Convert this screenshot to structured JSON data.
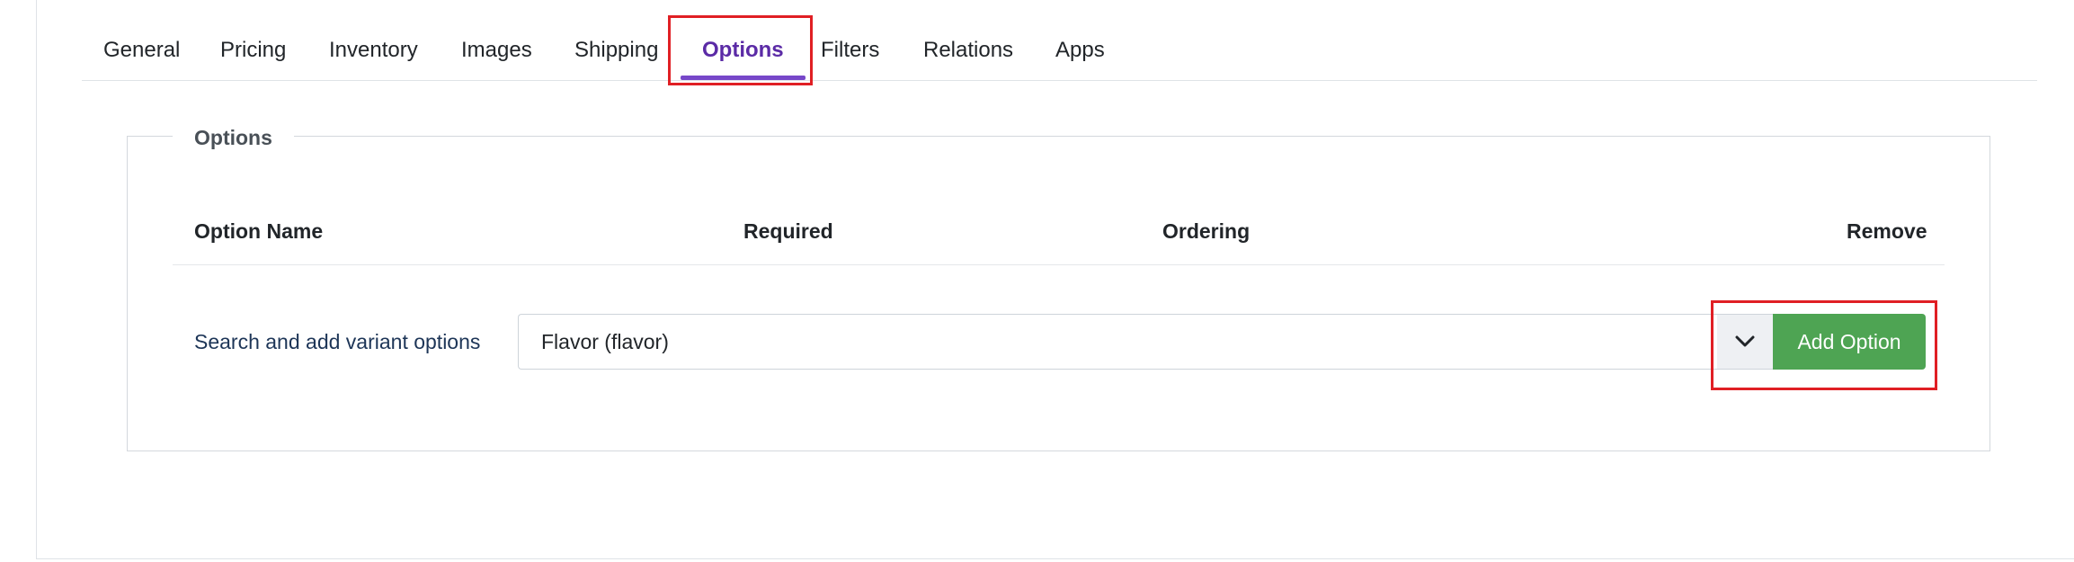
{
  "tabs": [
    {
      "label": "General"
    },
    {
      "label": "Pricing"
    },
    {
      "label": "Inventory"
    },
    {
      "label": "Images"
    },
    {
      "label": "Shipping"
    },
    {
      "label": "Options",
      "active": true
    },
    {
      "label": "Filters"
    },
    {
      "label": "Relations"
    },
    {
      "label": "Apps"
    }
  ],
  "options_panel": {
    "legend": "Options",
    "columns": {
      "option_name": "Option Name",
      "required": "Required",
      "ordering": "Ordering",
      "remove": "Remove"
    },
    "search_label": "Search and add variant options",
    "selected_option": "Flavor (flavor)",
    "add_button_label": "Add Option"
  },
  "colors": {
    "active_tab": "#5b2ba6",
    "active_tab_underline": "#7747c9",
    "add_button": "#4ea453",
    "highlight": "#e01f24"
  },
  "icons": {
    "select_toggle": "chevron-down-icon"
  }
}
